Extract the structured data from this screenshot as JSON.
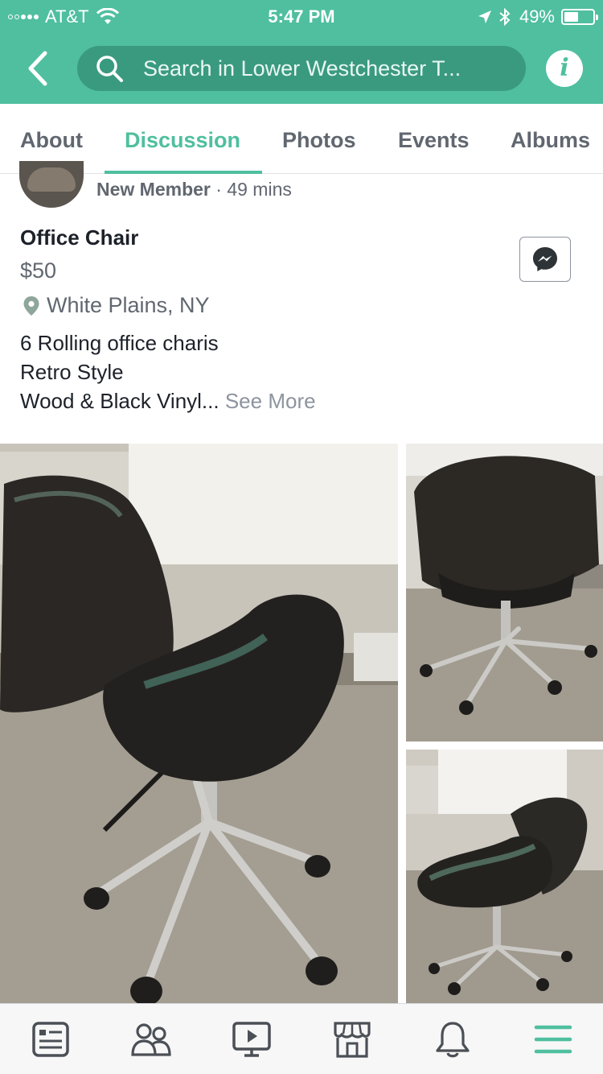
{
  "status_bar": {
    "carrier": "AT&T",
    "time": "5:47 PM",
    "battery_text": "49%",
    "battery_level": 0.49
  },
  "header": {
    "search_text": "Search in Lower Westchester T...",
    "accent_color": "#4fbf9f"
  },
  "tabs": [
    {
      "label": "About"
    },
    {
      "label": "Discussion",
      "active": true
    },
    {
      "label": "Photos"
    },
    {
      "label": "Events"
    },
    {
      "label": "Albums"
    }
  ],
  "post": {
    "author_role": "New Member",
    "time_separator": "·",
    "time_ago": "49 mins",
    "title": "Office Chair",
    "price": "$50",
    "location": "White Plains, NY",
    "description_lines": [
      "6 Rolling office charis",
      "Retro Style",
      "Wood & Black Vinyl..."
    ],
    "see_more": "See More"
  },
  "icons": {
    "back": "chevron-left-icon",
    "search": "search-icon",
    "info": "info-icon",
    "location": "map-pin-icon",
    "messenger": "messenger-icon"
  },
  "bottom_nav": [
    {
      "icon": "news-feed-icon"
    },
    {
      "icon": "groups-icon"
    },
    {
      "icon": "watch-video-icon"
    },
    {
      "icon": "marketplace-icon"
    },
    {
      "icon": "notifications-bell-icon"
    },
    {
      "icon": "menu-icon",
      "active": true
    }
  ]
}
